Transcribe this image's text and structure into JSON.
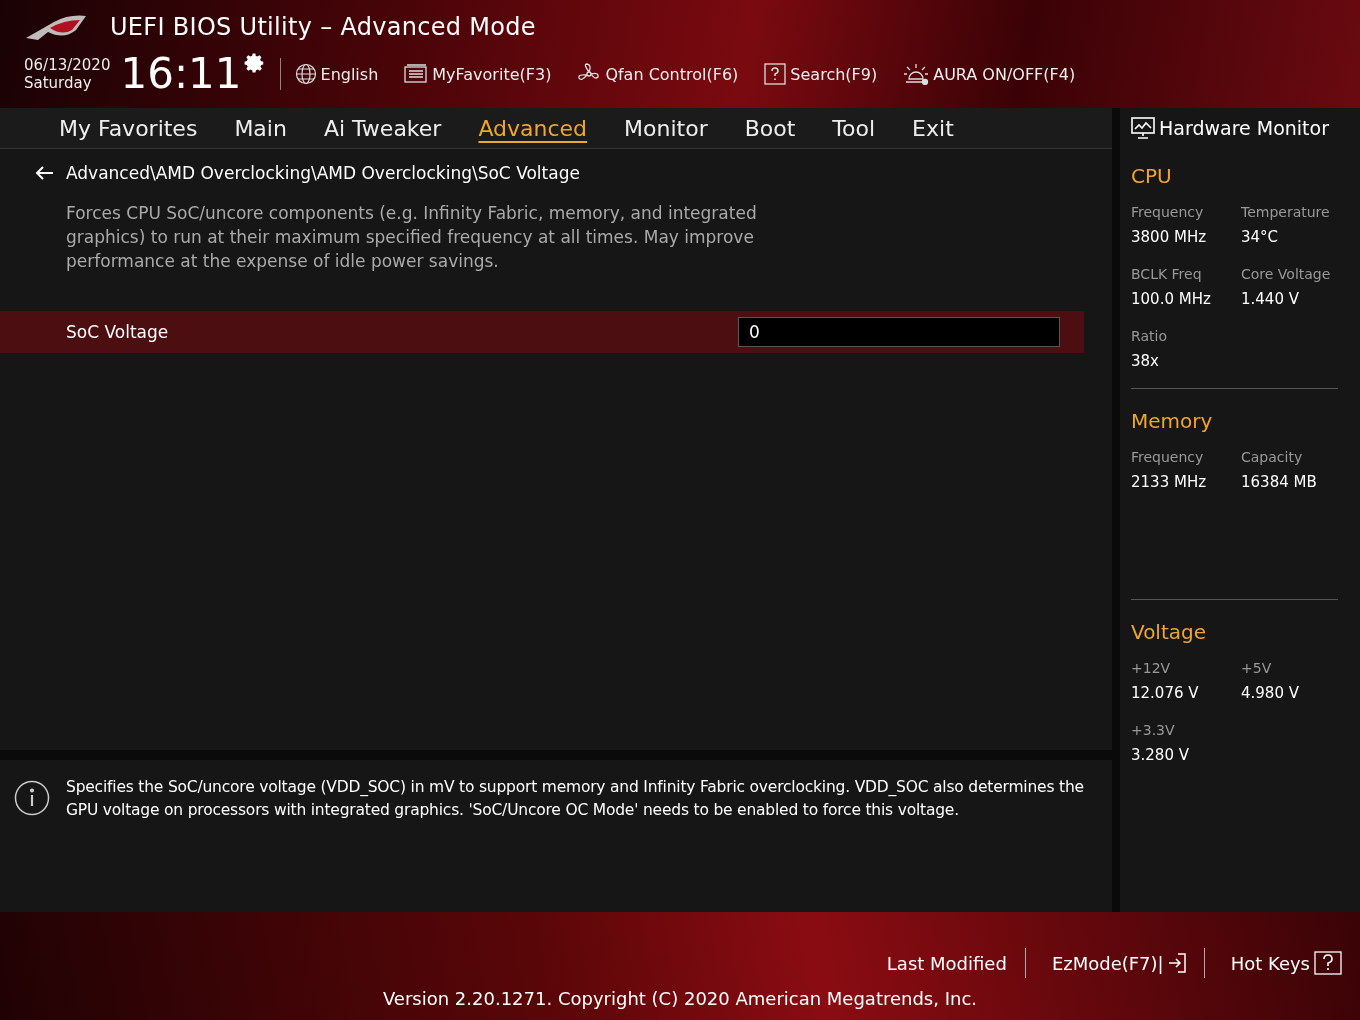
{
  "header": {
    "title": "UEFI BIOS Utility – Advanced Mode",
    "date": "06/13/2020",
    "day": "Saturday",
    "time": "16:11",
    "tools": [
      {
        "kind": "globe",
        "label": "English"
      },
      {
        "kind": "favorite",
        "label": "MyFavorite(F3)"
      },
      {
        "kind": "fan",
        "label": "Qfan Control(F6)"
      },
      {
        "kind": "search",
        "label": "Search(F9)"
      },
      {
        "kind": "aura",
        "label": "AURA ON/OFF(F4)"
      }
    ]
  },
  "tabs": [
    {
      "label": "My Favorites",
      "selected": false
    },
    {
      "label": "Main",
      "selected": false
    },
    {
      "label": "Ai Tweaker",
      "selected": false
    },
    {
      "label": "Advanced",
      "selected": true
    },
    {
      "label": "Monitor",
      "selected": false
    },
    {
      "label": "Boot",
      "selected": false
    },
    {
      "label": "Tool",
      "selected": false
    },
    {
      "label": "Exit",
      "selected": false
    }
  ],
  "breadcrumb": "Advanced\\AMD Overclocking\\AMD Overclocking\\SoC Voltage",
  "description": "Forces CPU SoC/uncore components (e.g. Infinity Fabric, memory, and integrated graphics) to run at their maximum specified frequency at all times. May improve performance at the expense of idle power savings.",
  "settings": [
    {
      "label": "SoC Voltage",
      "value": "0",
      "selected": true
    }
  ],
  "help": "Specifies the SoC/uncore voltage (VDD_SOC) in mV to support memory and Infinity Fabric overclocking. VDD_SOC also determines the GPU voltage on processors with integrated graphics. 'SoC/Uncore OC Mode' needs to be enabled to force this voltage.",
  "hardware_monitor": {
    "title": "Hardware Monitor",
    "sections": [
      {
        "title": "CPU",
        "items": [
          {
            "label": "Frequency",
            "value": "3800 MHz"
          },
          {
            "label": "Temperature",
            "value": "34°C"
          },
          {
            "label": "BCLK Freq",
            "value": "100.0 MHz"
          },
          {
            "label": "Core Voltage",
            "value": "1.440 V"
          },
          {
            "label": "Ratio",
            "value": "38x"
          }
        ]
      },
      {
        "title": "Memory",
        "items": [
          {
            "label": "Frequency",
            "value": "2133 MHz"
          },
          {
            "label": "Capacity",
            "value": "16384 MB"
          }
        ]
      },
      {
        "title": "Voltage",
        "items": [
          {
            "label": "+12V",
            "value": "12.076 V"
          },
          {
            "label": "+5V",
            "value": "4.980 V"
          },
          {
            "label": "+3.3V",
            "value": "3.280 V"
          }
        ]
      }
    ]
  },
  "footer": {
    "buttons": [
      {
        "kind": "plain",
        "label": "Last Modified"
      },
      {
        "kind": "exit",
        "label": "EzMode(F7)|"
      },
      {
        "kind": "help",
        "label": "Hot Keys"
      }
    ],
    "version": "Version 2.20.1271. Copyright (C) 2020 American Megatrends, Inc."
  }
}
